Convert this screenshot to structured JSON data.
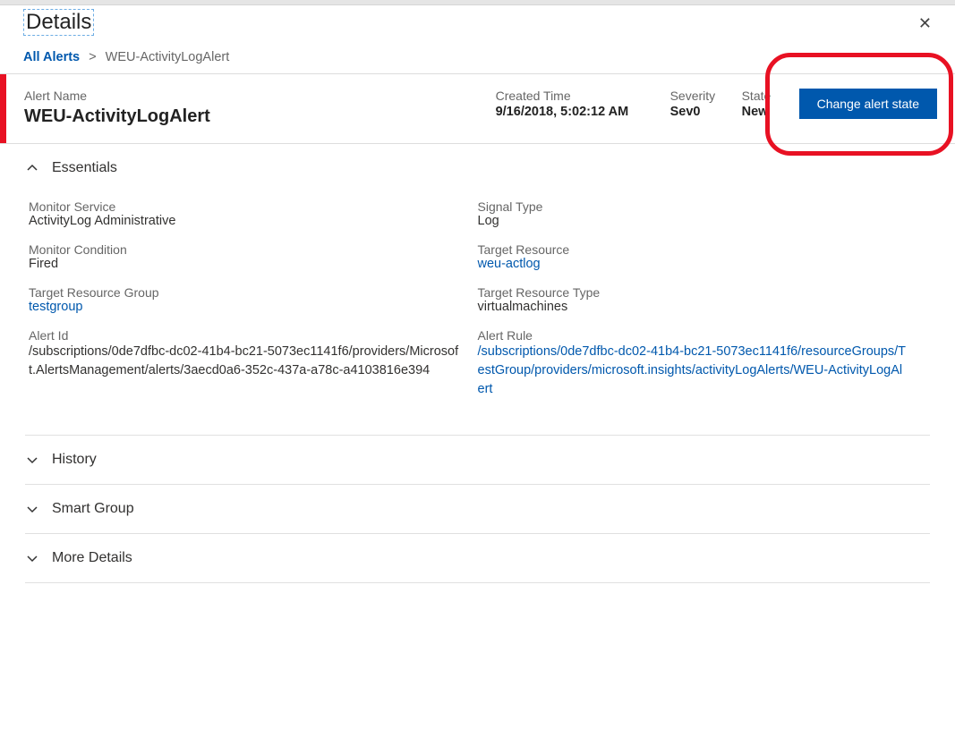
{
  "page": {
    "title": "Details"
  },
  "breadcrumb": {
    "all_alerts": "All Alerts",
    "separator": ">",
    "current": "WEU-ActivityLogAlert"
  },
  "summary": {
    "name_label": "Alert Name",
    "name_value": "WEU-ActivityLogAlert",
    "created_label": "Created Time",
    "created_value": "9/16/2018, 5:02:12 AM",
    "severity_label": "Severity",
    "severity_value": "Sev0",
    "state_label": "State",
    "state_value": "New",
    "button": "Change alert state"
  },
  "sections": {
    "essentials": "Essentials",
    "history": "History",
    "smart_group": "Smart Group",
    "more_details": "More Details"
  },
  "essentials": {
    "monitor_service": {
      "label": "Monitor Service",
      "value": "ActivityLog Administrative"
    },
    "signal_type": {
      "label": "Signal Type",
      "value": "Log"
    },
    "monitor_condition": {
      "label": "Monitor Condition",
      "value": "Fired"
    },
    "target_resource": {
      "label": "Target Resource",
      "value": "weu-actlog"
    },
    "target_resource_group": {
      "label": "Target Resource Group",
      "value": "testgroup"
    },
    "target_resource_type": {
      "label": "Target Resource Type",
      "value": "virtualmachines"
    },
    "alert_id": {
      "label": "Alert Id",
      "value": "/subscriptions/0de7dfbc-dc02-41b4-bc21-5073ec1141f6/providers/Microsoft.AlertsManagement/alerts/3aecd0a6-352c-437a-a78c-a4103816e394"
    },
    "alert_rule": {
      "label": "Alert Rule",
      "value": "/subscriptions/0de7dfbc-dc02-41b4-bc21-5073ec1141f6/resourceGroups/TestGroup/providers/microsoft.insights/activityLogAlerts/WEU-ActivityLogAlert"
    }
  }
}
